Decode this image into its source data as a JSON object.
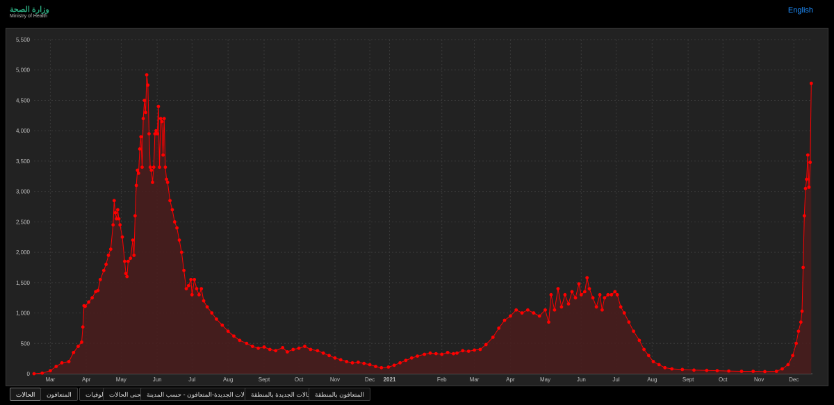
{
  "header": {
    "logo_ar": "وزارة الصحة",
    "logo_en": "Ministry of Health",
    "language_link": "English"
  },
  "tabs": [
    {
      "label": "الحالات",
      "active": true
    },
    {
      "label": "المتعافون",
      "active": false
    },
    {
      "label": "الوفيات",
      "active": false
    },
    {
      "label": "منحنى الحالات",
      "active": false
    },
    {
      "label": "الحالات الجديدة-المتعافون - حسب المدينة",
      "active": false
    },
    {
      "label": "الحالات الجديدة بالمنطقة",
      "active": false
    },
    {
      "label": "المتعافون بالمنطقة",
      "active": false
    }
  ],
  "colors": {
    "series": "#ff0000",
    "area_fill": "#4a1c1c",
    "grid": "#3a3a3a",
    "axis_text": "#bdbdbd",
    "panel_bg": "#222222"
  },
  "chart_data": {
    "type": "line",
    "title": "",
    "xlabel": "",
    "ylabel": "",
    "ylim": [
      0,
      5500
    ],
    "yticks": [
      0,
      500,
      1000,
      1500,
      2000,
      2500,
      3000,
      3500,
      4000,
      4500,
      5000,
      5500
    ],
    "ytick_labels": [
      "0",
      "500",
      "1,000",
      "1,500",
      "2,000",
      "2,500",
      "3,000",
      "3,500",
      "4,000",
      "4,500",
      "5,000",
      "5,500"
    ],
    "xlim": [
      "2020-03-01",
      "2021-12-31"
    ],
    "xtick_dates": [
      "2020-03-15",
      "2020-04-15",
      "2020-05-15",
      "2020-06-15",
      "2020-07-15",
      "2020-08-15",
      "2020-09-15",
      "2020-10-15",
      "2020-11-15",
      "2020-12-15",
      "2021-01-01",
      "2021-02-15",
      "2021-03-15",
      "2021-04-15",
      "2021-05-15",
      "2021-06-15",
      "2021-07-15",
      "2021-08-15",
      "2021-09-15",
      "2021-10-15",
      "2021-11-15",
      "2021-12-15"
    ],
    "xtick_labels": [
      "Mar",
      "Apr",
      "May",
      "Jun",
      "Jul",
      "Aug",
      "Sept",
      "Oct",
      "Nov",
      "Dec",
      "2021",
      "Feb",
      "Mar",
      "Apr",
      "May",
      "Jun",
      "Jul",
      "Aug",
      "Sept",
      "Oct",
      "Nov",
      "Dec"
    ],
    "grid": true,
    "legend": "none",
    "series": [
      {
        "points": [
          [
            "2020-03-01",
            0
          ],
          [
            "2020-03-08",
            10
          ],
          [
            "2020-03-15",
            50
          ],
          [
            "2020-03-20",
            120
          ],
          [
            "2020-03-25",
            180
          ],
          [
            "2020-03-31",
            200
          ],
          [
            "2020-04-04",
            350
          ],
          [
            "2020-04-08",
            450
          ],
          [
            "2020-04-11",
            520
          ],
          [
            "2020-04-12",
            770
          ],
          [
            "2020-04-13",
            1120
          ],
          [
            "2020-04-14",
            1110
          ],
          [
            "2020-04-17",
            1180
          ],
          [
            "2020-04-20",
            1250
          ],
          [
            "2020-04-23",
            1350
          ],
          [
            "2020-04-25",
            1370
          ],
          [
            "2020-04-27",
            1550
          ],
          [
            "2020-04-30",
            1700
          ],
          [
            "2020-05-02",
            1800
          ],
          [
            "2020-05-04",
            1950
          ],
          [
            "2020-05-06",
            2050
          ],
          [
            "2020-05-08",
            2450
          ],
          [
            "2020-05-09",
            2850
          ],
          [
            "2020-05-10",
            2650
          ],
          [
            "2020-05-11",
            2550
          ],
          [
            "2020-05-12",
            2700
          ],
          [
            "2020-05-13",
            2550
          ],
          [
            "2020-05-14",
            2450
          ],
          [
            "2020-05-16",
            2250
          ],
          [
            "2020-05-18",
            1850
          ],
          [
            "2020-05-19",
            1650
          ],
          [
            "2020-05-20",
            1600
          ],
          [
            "2020-05-21",
            1850
          ],
          [
            "2020-05-23",
            1900
          ],
          [
            "2020-05-25",
            2200
          ],
          [
            "2020-05-26",
            1950
          ],
          [
            "2020-05-27",
            2600
          ],
          [
            "2020-05-28",
            3100
          ],
          [
            "2020-05-29",
            3350
          ],
          [
            "2020-05-30",
            3300
          ],
          [
            "2020-05-31",
            3700
          ],
          [
            "2020-06-01",
            3900
          ],
          [
            "2020-06-02",
            3400
          ],
          [
            "2020-06-03",
            4200
          ],
          [
            "2020-06-04",
            4500
          ],
          [
            "2020-06-05",
            4300
          ],
          [
            "2020-06-06",
            4920
          ],
          [
            "2020-06-07",
            4750
          ],
          [
            "2020-06-08",
            3950
          ],
          [
            "2020-06-09",
            3400
          ],
          [
            "2020-06-10",
            3350
          ],
          [
            "2020-06-11",
            3150
          ],
          [
            "2020-06-12",
            3400
          ],
          [
            "2020-06-13",
            3950
          ],
          [
            "2020-06-14",
            4000
          ],
          [
            "2020-06-15",
            3950
          ],
          [
            "2020-06-16",
            4400
          ],
          [
            "2020-06-17",
            3400
          ],
          [
            "2020-06-18",
            4200
          ],
          [
            "2020-06-19",
            4150
          ],
          [
            "2020-06-20",
            3600
          ],
          [
            "2020-06-21",
            4200
          ],
          [
            "2020-06-22",
            3400
          ],
          [
            "2020-06-23",
            3200
          ],
          [
            "2020-06-24",
            3150
          ],
          [
            "2020-06-26",
            2850
          ],
          [
            "2020-06-28",
            2700
          ],
          [
            "2020-06-30",
            2500
          ],
          [
            "2020-07-02",
            2400
          ],
          [
            "2020-07-04",
            2200
          ],
          [
            "2020-07-06",
            2000
          ],
          [
            "2020-07-08",
            1700
          ],
          [
            "2020-07-10",
            1400
          ],
          [
            "2020-07-12",
            1450
          ],
          [
            "2020-07-14",
            1550
          ],
          [
            "2020-07-15",
            1300
          ],
          [
            "2020-07-17",
            1550
          ],
          [
            "2020-07-19",
            1400
          ],
          [
            "2020-07-21",
            1300
          ],
          [
            "2020-07-23",
            1400
          ],
          [
            "2020-07-25",
            1200
          ],
          [
            "2020-07-28",
            1100
          ],
          [
            "2020-08-01",
            1000
          ],
          [
            "2020-08-05",
            900
          ],
          [
            "2020-08-10",
            800
          ],
          [
            "2020-08-15",
            700
          ],
          [
            "2020-08-20",
            620
          ],
          [
            "2020-08-25",
            550
          ],
          [
            "2020-08-31",
            500
          ],
          [
            "2020-09-05",
            450
          ],
          [
            "2020-09-10",
            420
          ],
          [
            "2020-09-15",
            440
          ],
          [
            "2020-09-20",
            400
          ],
          [
            "2020-09-25",
            380
          ],
          [
            "2020-10-01",
            430
          ],
          [
            "2020-10-05",
            360
          ],
          [
            "2020-10-10",
            400
          ],
          [
            "2020-10-15",
            420
          ],
          [
            "2020-10-20",
            450
          ],
          [
            "2020-10-25",
            400
          ],
          [
            "2020-10-31",
            380
          ],
          [
            "2020-11-05",
            340
          ],
          [
            "2020-11-10",
            300
          ],
          [
            "2020-11-15",
            260
          ],
          [
            "2020-11-20",
            230
          ],
          [
            "2020-11-25",
            200
          ],
          [
            "2020-11-30",
            180
          ],
          [
            "2020-12-05",
            190
          ],
          [
            "2020-12-10",
            170
          ],
          [
            "2020-12-15",
            150
          ],
          [
            "2020-12-20",
            120
          ],
          [
            "2020-12-25",
            100
          ],
          [
            "2020-12-31",
            110
          ],
          [
            "2021-01-05",
            140
          ],
          [
            "2021-01-10",
            180
          ],
          [
            "2021-01-15",
            220
          ],
          [
            "2021-01-20",
            260
          ],
          [
            "2021-01-25",
            290
          ],
          [
            "2021-01-31",
            320
          ],
          [
            "2021-02-05",
            340
          ],
          [
            "2021-02-10",
            330
          ],
          [
            "2021-02-15",
            320
          ],
          [
            "2021-02-20",
            350
          ],
          [
            "2021-02-25",
            330
          ],
          [
            "2021-02-28",
            340
          ],
          [
            "2021-03-05",
            380
          ],
          [
            "2021-03-10",
            370
          ],
          [
            "2021-03-15",
            390
          ],
          [
            "2021-03-20",
            400
          ],
          [
            "2021-03-25",
            480
          ],
          [
            "2021-03-31",
            600
          ],
          [
            "2021-04-05",
            750
          ],
          [
            "2021-04-10",
            880
          ],
          [
            "2021-04-15",
            950
          ],
          [
            "2021-04-20",
            1050
          ],
          [
            "2021-04-25",
            1000
          ],
          [
            "2021-04-30",
            1050
          ],
          [
            "2021-05-05",
            1000
          ],
          [
            "2021-05-10",
            950
          ],
          [
            "2021-05-15",
            1050
          ],
          [
            "2021-05-18",
            850
          ],
          [
            "2021-05-20",
            1300
          ],
          [
            "2021-05-23",
            1050
          ],
          [
            "2021-05-26",
            1400
          ],
          [
            "2021-05-29",
            1100
          ],
          [
            "2021-06-01",
            1300
          ],
          [
            "2021-06-04",
            1150
          ],
          [
            "2021-06-07",
            1350
          ],
          [
            "2021-06-10",
            1250
          ],
          [
            "2021-06-13",
            1480
          ],
          [
            "2021-06-15",
            1300
          ],
          [
            "2021-06-18",
            1350
          ],
          [
            "2021-06-20",
            1580
          ],
          [
            "2021-06-22",
            1400
          ],
          [
            "2021-06-25",
            1250
          ],
          [
            "2021-06-28",
            1100
          ],
          [
            "2021-07-01",
            1300
          ],
          [
            "2021-07-03",
            1050
          ],
          [
            "2021-07-05",
            1250
          ],
          [
            "2021-07-08",
            1300
          ],
          [
            "2021-07-11",
            1300
          ],
          [
            "2021-07-14",
            1350
          ],
          [
            "2021-07-16",
            1300
          ],
          [
            "2021-07-19",
            1100
          ],
          [
            "2021-07-22",
            1000
          ],
          [
            "2021-07-26",
            850
          ],
          [
            "2021-07-30",
            700
          ],
          [
            "2021-08-04",
            550
          ],
          [
            "2021-08-08",
            400
          ],
          [
            "2021-08-12",
            300
          ],
          [
            "2021-08-16",
            200
          ],
          [
            "2021-08-21",
            150
          ],
          [
            "2021-08-26",
            100
          ],
          [
            "2021-09-01",
            80
          ],
          [
            "2021-09-10",
            70
          ],
          [
            "2021-09-20",
            60
          ],
          [
            "2021-10-01",
            55
          ],
          [
            "2021-10-10",
            50
          ],
          [
            "2021-10-20",
            45
          ],
          [
            "2021-10-31",
            40
          ],
          [
            "2021-11-10",
            40
          ],
          [
            "2021-11-20",
            35
          ],
          [
            "2021-11-30",
            40
          ],
          [
            "2021-12-05",
            80
          ],
          [
            "2021-12-10",
            150
          ],
          [
            "2021-12-14",
            300
          ],
          [
            "2021-12-17",
            500
          ],
          [
            "2021-12-19",
            700
          ],
          [
            "2021-12-21",
            850
          ],
          [
            "2021-12-22",
            1030
          ],
          [
            "2021-12-23",
            1750
          ],
          [
            "2021-12-24",
            2600
          ],
          [
            "2021-12-25",
            3050
          ],
          [
            "2021-12-26",
            3200
          ],
          [
            "2021-12-27",
            3600
          ],
          [
            "2021-12-28",
            3070
          ],
          [
            "2021-12-29",
            3480
          ],
          [
            "2021-12-30",
            4780
          ]
        ]
      }
    ]
  }
}
